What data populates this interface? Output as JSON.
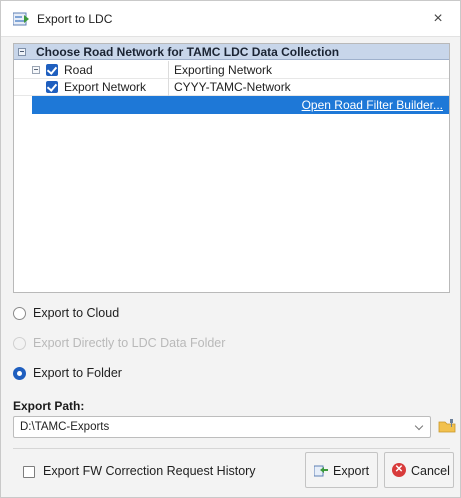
{
  "window": {
    "title": "Export to LDC",
    "close_glyph": "×"
  },
  "tree": {
    "header": "Choose Road Network for TAMC LDC Data Collection",
    "rows": [
      {
        "name": "Road",
        "value": "Exporting Network"
      },
      {
        "name": "Export Network",
        "value": "CYYY-TAMC-Network"
      }
    ],
    "filter_link": "Open Road Filter Builder..."
  },
  "options": {
    "cloud": "Export to Cloud",
    "ldc_folder": "Export Directly to LDC Data Folder",
    "folder": "Export to Folder",
    "selected": "folder"
  },
  "path": {
    "label": "Export Path:",
    "value": "D:\\TAMC-Exports"
  },
  "footer": {
    "history_label": "Export FW Correction Request History",
    "export_label": "Export",
    "cancel_label": "Cancel"
  },
  "icons": {
    "app": "export-window-icon",
    "close": "close-icon",
    "folder": "folder-browse-icon",
    "export": "export-icon",
    "cancel": "cancel-icon"
  },
  "colors": {
    "accent": "#1f5fbf",
    "selection": "#1e78d7",
    "header_bg": "#c8d6ea",
    "cancel_red": "#d83b3b"
  }
}
